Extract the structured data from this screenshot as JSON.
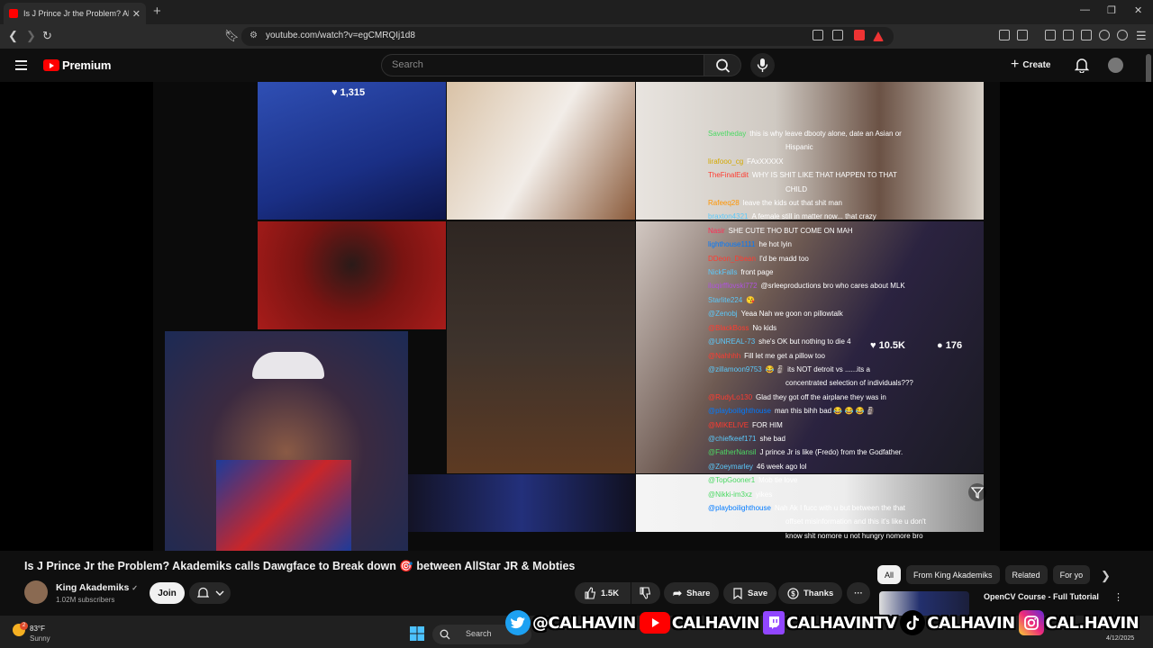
{
  "browser": {
    "tab_title": "Is J Prince Jr the Problem? Akademiks",
    "tab_close": "✕",
    "new_tab": "+",
    "url": "youtube.com/watch?v=egCMRQIj1d8"
  },
  "header": {
    "logo_text": "Premium",
    "search_placeholder": "Search",
    "create_label": "Create",
    "create_icon": "+"
  },
  "video": {
    "overlay_like_top": "1,315",
    "overlay_like_count": "10.5K",
    "overlay_comment_count": "176",
    "chat": [
      {
        "user": "Savetheday",
        "user_color": "#4cd964",
        "text": "this is why leave dbooty alone, date an Asian or"
      },
      {
        "user": "",
        "user_color": "#ffffff",
        "text": "Hispanic"
      },
      {
        "user": "lirafooo_cg",
        "user_color": "#d4a900",
        "text": "FAxXXXXX"
      },
      {
        "user": "TheFinalEdit",
        "user_color": "#ff3b30",
        "text": "WHY IS SHIT LIKE THAT HAPPEN TO THAT"
      },
      {
        "user": "",
        "user_color": "#ffffff",
        "text": "CHILD"
      },
      {
        "user": "Rafeeq28",
        "user_color": "#ff9500",
        "text": "leave the kids out that shit man"
      },
      {
        "user": "braxton4321",
        "user_color": "#5ac8fa",
        "text": "A female still in matter now... that crazy"
      },
      {
        "user": "Nasir",
        "user_color": "#ff2d55",
        "text": "SHE CUTE THO BUT COME ON MAH"
      },
      {
        "user": "lighthouse1111",
        "user_color": "#007aff",
        "text": "he hot lyin"
      },
      {
        "user": "DDeon_Dbean",
        "user_color": "#ff3b30",
        "text": "I'd be madd too"
      },
      {
        "user": "NickFalls",
        "user_color": "#5ac8fa",
        "text": "front page"
      },
      {
        "user": "iluqirfflovski772",
        "user_color": "#af52de",
        "text": "@srleeproductions bro who cares about MLK"
      },
      {
        "user": "Starlite224",
        "user_color": "#5ac8fa",
        "text": "😘"
      },
      {
        "user": "@Zenobj",
        "user_color": "#5ac8fa",
        "text": "Yeaa Nah we goon on pillowtalk"
      },
      {
        "user": "@BlackBoss",
        "user_color": "#ff3b30",
        "text": "No kids"
      },
      {
        "user": "@UNREAL-73",
        "user_color": "#5ac8fa",
        "text": "she's OK but nothing to die 4"
      },
      {
        "user": "@Nahhhh",
        "user_color": "#ff3b30",
        "text": "Fill let me get a pillow too"
      },
      {
        "user": "@zillamoon9753",
        "user_color": "#5ac8fa",
        "text": "😂 🗿 its NOT detroit vs ......its a"
      },
      {
        "user": "",
        "user_color": "#ffffff",
        "text": "concentrated selection of individuals???"
      },
      {
        "user": "@RudyLo130",
        "user_color": "#ff3b30",
        "text": "Glad they got off the airplane they was in"
      },
      {
        "user": "@playboilighthouse",
        "user_color": "#007aff",
        "text": "man this bihh bad 😂 😂 😂 🗿"
      },
      {
        "user": "@MIKELIVE",
        "user_color": "#ff3b30",
        "text": "FOR HIM"
      },
      {
        "user": "@chiefkeef171",
        "user_color": "#5ac8fa",
        "text": "she bad"
      },
      {
        "user": "@FatherNansil",
        "user_color": "#4cd964",
        "text": "J prince Jr is like (Fredo) from the Godfather."
      },
      {
        "user": "@Zoeymarley",
        "user_color": "#5ac8fa",
        "text": "46 week ago lol"
      },
      {
        "user": "@TopGooner1",
        "user_color": "#4cd964",
        "text": "Mob tie love"
      },
      {
        "user": "@Nikki-im3xz",
        "user_color": "#4cd964",
        "text": "yikes"
      },
      {
        "user": "@playboilighthouse",
        "user_color": "#007aff",
        "text": "Nah Ak I fucc with u but between the that"
      },
      {
        "user": "",
        "user_color": "#ffffff",
        "text": "offset misinformation and this it's like u don't"
      },
      {
        "user": "",
        "user_color": "#ffffff",
        "text": "know shit nomore u not hungry nomore bro"
      }
    ]
  },
  "below": {
    "title": "Is J Prince Jr the Problem? Akademiks calls Dawgface to Break down 🎯 between AllStar JR & Mobties",
    "channel_name": "King Akademiks",
    "verified": "✓",
    "subscribers": "1.02M subscribers",
    "join_label": "Join",
    "like_count": "1.5K",
    "share_label": "Share",
    "save_label": "Save",
    "thanks_label": "Thanks",
    "more_label": "···",
    "chips": [
      "All",
      "From King Akademiks",
      "Related",
      "For yo"
    ],
    "up_next_title": "OpenCV Course - Full Tutorial"
  },
  "taskbar": {
    "temp": "83°F",
    "condition": "Sunny",
    "weather_badge": "2",
    "search_label": "Search",
    "date": "4/12/2025"
  },
  "social": {
    "twitter": "@CALHAVIN",
    "youtube": "CALHAVIN",
    "twitch": "CALHAVINTV",
    "tiktok": "CALHAVIN",
    "instagram": "CAL.HAVIN"
  },
  "colors": {
    "accent_red": "#ff0000",
    "bg": "#0f0f0f",
    "chip_bg": "#272727"
  }
}
